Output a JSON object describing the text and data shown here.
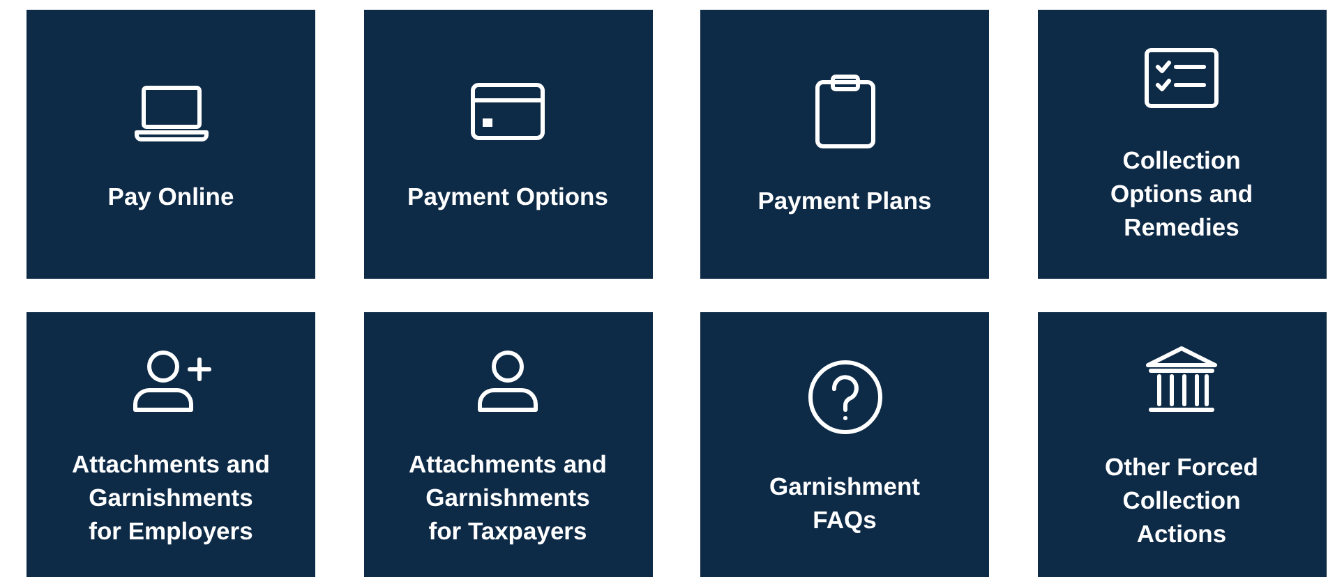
{
  "tiles": [
    {
      "label": "Pay Online"
    },
    {
      "label": "Payment Options"
    },
    {
      "label": "Payment Plans"
    },
    {
      "label": "Collection\nOptions and\nRemedies"
    },
    {
      "label": "Attachments and\nGarnishments\nfor Employers"
    },
    {
      "label": "Attachments and\nGarnishments\nfor Taxpayers"
    },
    {
      "label": "Garnishment\nFAQs"
    },
    {
      "label": "Other Forced\nCollection\nActions"
    }
  ]
}
